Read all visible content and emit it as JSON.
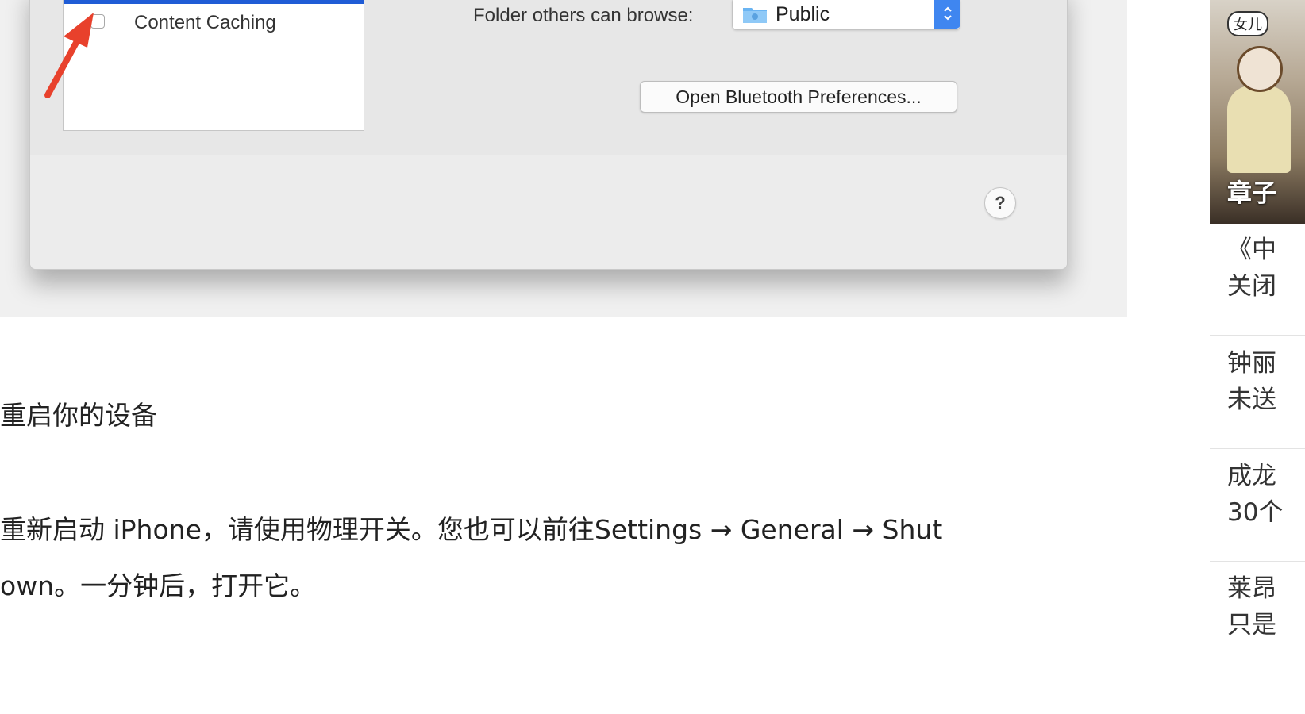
{
  "screenshot": {
    "sharing_services": [
      {
        "label": "Content Caching",
        "checked": false
      }
    ],
    "folder_browse": {
      "label": "Folder others can browse:",
      "value": "Public"
    },
    "bluetooth_button": "Open Bluetooth Preferences...",
    "help_button": "?",
    "selection_color": "#1f5cd6",
    "accent_color": "#3f86f0",
    "annotation_arrow_color": "#e8412c"
  },
  "article": {
    "heading": "重启你的设备",
    "para_line_1": "重新启动 iPhone，请使用物理开关。您也可以前往Settings → General → Shut",
    "para_line_2": "own。一分钟后，打开它。",
    "para_line_3": ""
  },
  "sidebar": {
    "thumbnail": {
      "badge": "女儿",
      "caption": "章子"
    },
    "news": [
      {
        "line1": "《中",
        "line2": "关闭"
      },
      {
        "line1": "钟丽",
        "line2": "未送"
      },
      {
        "line1": "成龙",
        "line2": "30个"
      },
      {
        "line1": "莱昂",
        "line2": "只是"
      }
    ]
  }
}
